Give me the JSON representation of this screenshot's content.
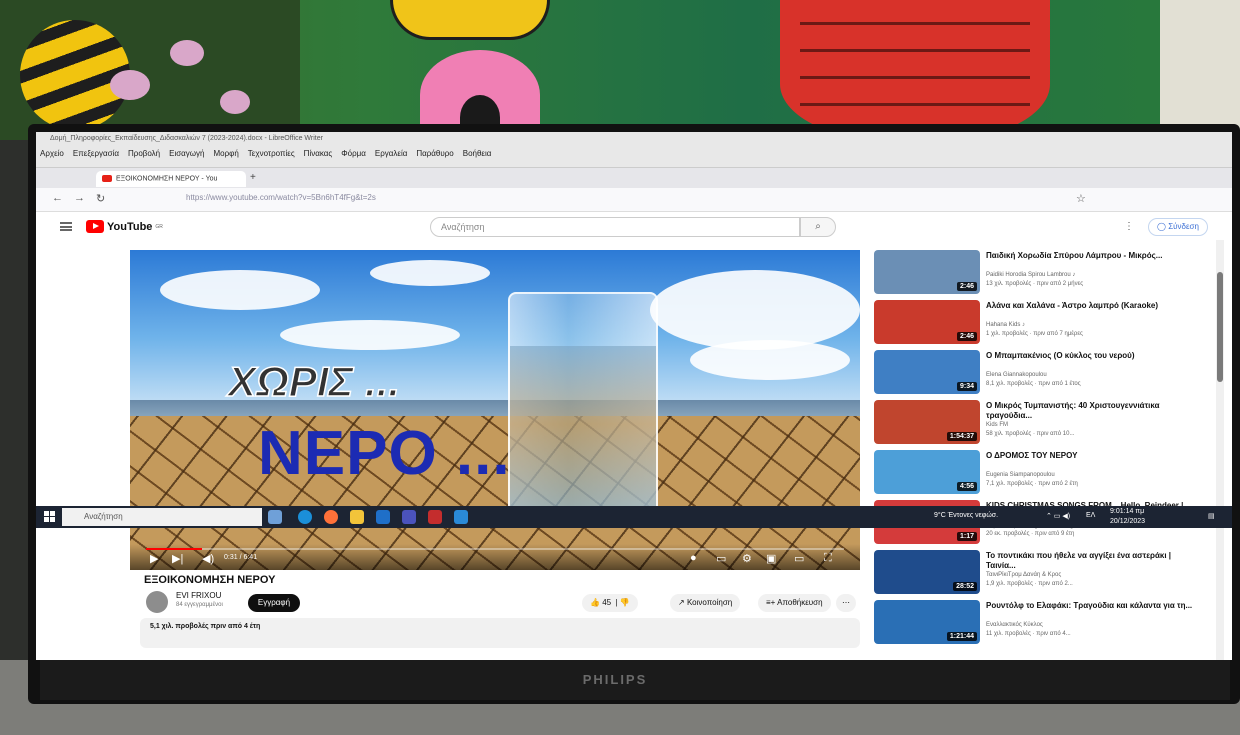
{
  "writer": {
    "title": "Δομή_Πληροφορίες_Εκπαίδευσης_Διδασκαλιών 7 (2023-2024).docx - LibreOffice Writer",
    "menu": [
      "Αρχείο",
      "Επεξεργασία",
      "Προβολή",
      "Εισαγωγή",
      "Μορφή",
      "Τεχνοτροπίες",
      "Πίνακας",
      "Φόρμα",
      "Εργαλεία",
      "Παράθυρο",
      "Βοήθεια"
    ]
  },
  "browser": {
    "tab_title": "ΕΞΟΙΚΟΝΟΜΗΣΗ ΝΕΡΟΥ - You",
    "url": "https://www.youtube.com/watch?v=5Bn6hT4fFg&t=2s"
  },
  "youtube": {
    "logo": "YouTube",
    "region": "GR",
    "search_placeholder": "Αναζήτηση",
    "signin": "Σύνδεση"
  },
  "video": {
    "overlay_line1": "ΧΩΡΙΣ ...",
    "overlay_line2": "ΝΕΡΟ ...",
    "time": "0:31 / 6:41",
    "progress": 0.08,
    "title": "ΕΞΟΙΚΟΝΟΜΗΣΗ ΝΕΡΟΥ",
    "channel": "EVI FRIXOU",
    "subscribers": "84 εγγεγραμμένοι",
    "subscribe": "Εγγραφή",
    "likes": "45",
    "share": "Κοινοποίηση",
    "save": "Αποθήκευση",
    "views": "5,1 χιλ. προβολές  πριν από 4 έτη"
  },
  "sidebar": [
    {
      "title": "Παιδική Χορωδία Σπύρου Λάμπρου - Μικρός...",
      "channel": "Paidiki Horodia Spirou Lambrou ♪",
      "meta": "13 χιλ. προβολές · πριν από 2 μήνες",
      "duration": "2:46",
      "color": "#6b8fb5"
    },
    {
      "title": "Αλάνα και Χαλάνα - Άστρο λαμπρό (Karaoke)",
      "channel": "Hahana Kids ♪",
      "meta": "1 χιλ. προβολές · πριν από 7 ημέρες",
      "duration": "2:46",
      "color": "#c93a2c"
    },
    {
      "title": "Ο Μπαμπακένιος (Ο κύκλος του νερού)",
      "channel": "Elena Giannakopoulou",
      "meta": "8,1 χιλ. προβολές · πριν από 1 έτος",
      "duration": "9:34",
      "color": "#3f7fc4"
    },
    {
      "title": "Ο Μικρός Τυμπανιστής: 40 Χριστουγεννιάτικα τραγούδια...",
      "channel": "Kids FM",
      "meta": "58 χιλ. προβολές · πριν από 10...",
      "duration": "1:54:37",
      "color": "#c0452e"
    },
    {
      "title": "Ο ΔΡΟΜΟΣ ΤΟΥ ΝΕΡΟΥ",
      "channel": "Eugenia Siampanopoulou",
      "meta": "7,1 χιλ. προβολές · πριν από 2 έτη",
      "duration": "4:56",
      "color": "#4d9fd8"
    },
    {
      "title": "KIDS CHRISTMAS SONGS FROM... Hello, Reindeer | Children's Christmas Song | Super Simpl...",
      "channel": "Super Simple Songs - Kids Songs ✓",
      "meta": "20 εκ. προβολές · πριν από 9 έτη",
      "duration": "1:17",
      "color": "#d43b3b"
    },
    {
      "title": "Το ποντικάκι που ήθελε να αγγίξει ένα αστεράκι | Ταινία...",
      "channel": "ΤαινιΡίκιΤρομ Δανάη & Κρος",
      "meta": "1,9 χιλ. προβολές · πριν από 2...",
      "duration": "28:52",
      "color": "#1f4c8c"
    },
    {
      "title": "Ρουντόλφ το Ελαφάκι: Τραγούδια και κάλαντα για τη...",
      "channel": "Εναλλακτικός Κύκλος",
      "meta": "11 χιλ. προβολές · πριν από 4...",
      "duration": "1:21:44",
      "color": "#2a6fb5"
    }
  ],
  "taskbar": {
    "search": "Αναζήτηση",
    "weather": "9°C  Έντονες νεφώσ.",
    "lang": "ΕΛ",
    "time": "9:01:14 πμ",
    "date": "20/12/2023"
  },
  "monitor_brand": "PHILIPS"
}
